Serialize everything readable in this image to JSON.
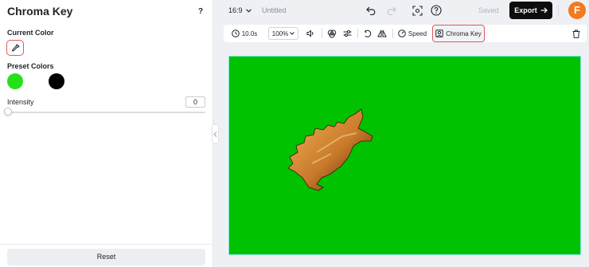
{
  "panel": {
    "title": "Chroma Key",
    "help": "?",
    "current_color_label": "Current Color",
    "preset_colors_label": "Preset Colors",
    "preset_colors": [
      "#26e01a",
      "#ffffff",
      "#000000"
    ],
    "intensity_label": "Intensity",
    "intensity_value": "0",
    "reset_label": "Reset"
  },
  "topbar": {
    "aspect_ratio": "16:9",
    "doc_title": "Untitled",
    "saved_label": "Saved",
    "export_label": "Export",
    "logo_letter": "F",
    "brand_color": "#f4791f"
  },
  "toolbar": {
    "duration": "10.0s",
    "zoom": "100%",
    "speed_label": "Speed",
    "chroma_key_label": "Chroma Key"
  },
  "canvas": {
    "background_color": "#00c200"
  }
}
